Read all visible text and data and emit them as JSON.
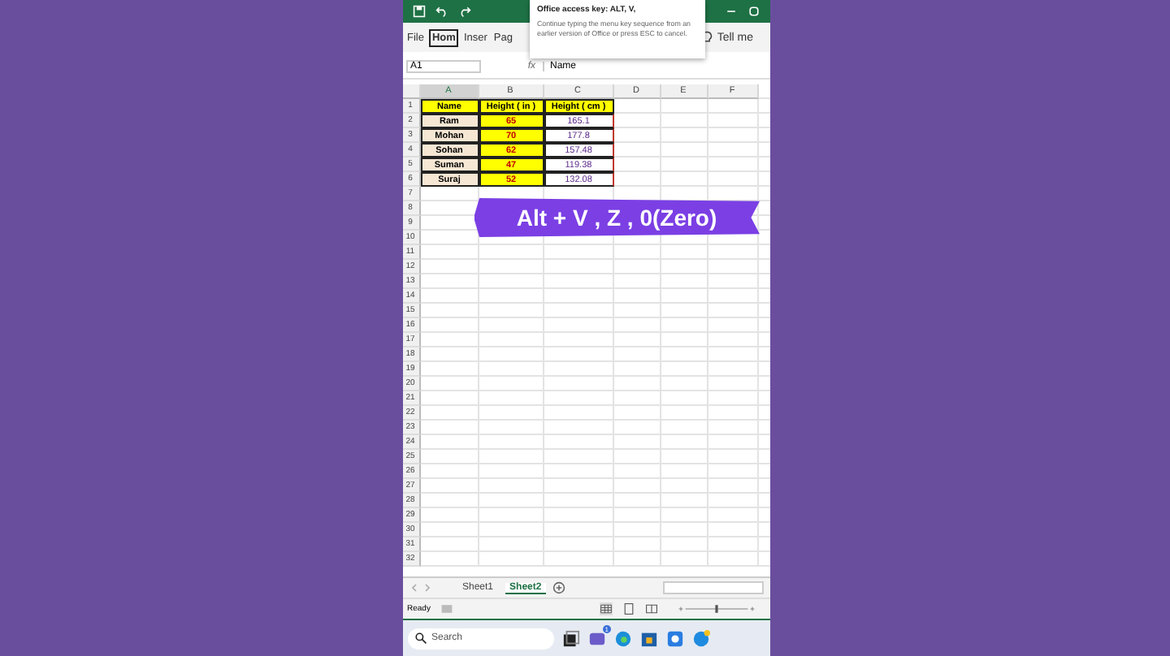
{
  "ribbon_tabs": [
    {
      "label": "File",
      "selected": false
    },
    {
      "label": "Hom",
      "selected": true
    },
    {
      "label": "Inser",
      "selected": false
    },
    {
      "label": "Pag",
      "selected": false
    }
  ],
  "tell_me": "Tell me",
  "tooltip": {
    "title": "Office access key: ALT, V,",
    "body": "Continue typing the menu key sequence from an earlier version of Office or press ESC to cancel."
  },
  "name_box": "A1",
  "function_label": "fx",
  "formula": "Name",
  "columns": [
    "A",
    "B",
    "C",
    "D",
    "E",
    "F"
  ],
  "table": [
    {
      "a": "Name",
      "b": "Height ( in )",
      "c": "Height ( cm )",
      "kind": "header"
    },
    {
      "a": "Ram",
      "b": "65",
      "c": "165.1",
      "kind": "data"
    },
    {
      "a": "Mohan",
      "b": "70",
      "c": "177.8",
      "kind": "data"
    },
    {
      "a": "Sohan",
      "b": "62",
      "c": "157.48",
      "kind": "data"
    },
    {
      "a": "Suman",
      "b": "47",
      "c": "119.38",
      "kind": "data"
    },
    {
      "a": "Suraj",
      "b": "52",
      "c": "132.08",
      "kind": "data"
    }
  ],
  "row_numbers": [
    "1",
    "2",
    "3",
    "4",
    "5",
    "6",
    "7",
    "8",
    "9",
    "10",
    "11",
    "12",
    "13",
    "14",
    "15",
    "16",
    "17",
    "18",
    "19",
    "20",
    "21",
    "22",
    "23",
    "24",
    "25",
    "26",
    "27",
    "28",
    "29",
    "30",
    "31",
    "32"
  ],
  "banner": "Alt + V , Z , 0(Zero)",
  "sheets": [
    {
      "label": "Sheet1",
      "selected": false
    },
    {
      "label": "Sheet2",
      "selected": true
    }
  ],
  "status": "Ready",
  "zoom": {
    "level": 0.5
  },
  "taskbar": {
    "search_placeholder": "Search",
    "badge": "1"
  }
}
